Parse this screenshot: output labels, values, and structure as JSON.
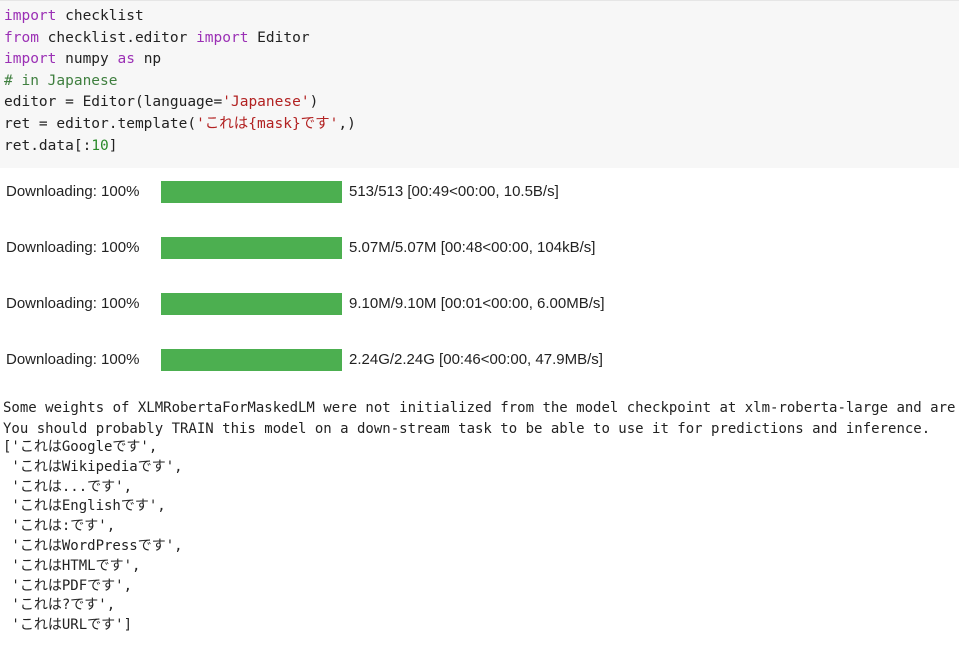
{
  "code": {
    "lines": [
      [
        {
          "t": "import",
          "c": "kw"
        },
        {
          "t": " checklist",
          "c": ""
        }
      ],
      [
        {
          "t": "from",
          "c": "kw"
        },
        {
          "t": " checklist.editor ",
          "c": ""
        },
        {
          "t": "import",
          "c": "kw"
        },
        {
          "t": " Editor",
          "c": ""
        }
      ],
      [
        {
          "t": "import",
          "c": "kw"
        },
        {
          "t": " numpy ",
          "c": ""
        },
        {
          "t": "as",
          "c": "kw"
        },
        {
          "t": " np",
          "c": ""
        }
      ],
      [
        {
          "t": "# in Japanese",
          "c": "cm"
        }
      ],
      [
        {
          "t": "editor = Editor(language=",
          "c": ""
        },
        {
          "t": "'Japanese'",
          "c": "st"
        },
        {
          "t": ")",
          "c": ""
        }
      ],
      [
        {
          "t": "ret = editor.template(",
          "c": ""
        },
        {
          "t": "'これは{mask}です'",
          "c": "st"
        },
        {
          "t": ",)",
          "c": ""
        }
      ],
      [
        {
          "t": "ret.data[:",
          "c": ""
        },
        {
          "t": "10",
          "c": "nm"
        },
        {
          "t": "]",
          "c": ""
        }
      ]
    ]
  },
  "downloads": [
    {
      "label": "Downloading: 100%",
      "progress": 1.0,
      "status": "513/513 [00:49<00:00, 10.5B/s]"
    },
    {
      "label": "Downloading: 100%",
      "progress": 1.0,
      "status": "5.07M/5.07M [00:48<00:00, 104kB/s]"
    },
    {
      "label": "Downloading: 100%",
      "progress": 1.0,
      "status": "9.10M/9.10M [00:01<00:00, 6.00MB/s]"
    },
    {
      "label": "Downloading: 100%",
      "progress": 1.0,
      "status": "2.24G/2.24G [00:46<00:00, 47.9MB/s]"
    }
  ],
  "stderr": [
    "Some weights of XLMRobertaForMaskedLM were not initialized from the model checkpoint at xlm-roberta-large and are newly",
    "You should probably TRAIN this model on a down-stream task to be able to use it for predictions and inference."
  ],
  "output": [
    "['これはGoogleです',",
    " 'これはWikipediaです',",
    " 'これは...です',",
    " 'これはEnglishです',",
    " 'これは:です',",
    " 'これはWordPressです',",
    " 'これはHTMLです',",
    " 'これはPDFです',",
    " 'これは?です',",
    " 'これはURLです']"
  ],
  "colors": {
    "cell_bg": "#f7f7f7",
    "progress_fill": "#4caf50",
    "keyword": "#9b30b5",
    "comment": "#3f7f3f",
    "string": "#b22222",
    "number": "#2a8a2a"
  }
}
